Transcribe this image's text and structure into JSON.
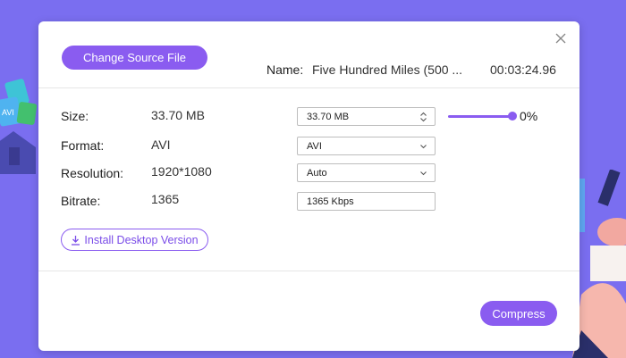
{
  "header": {
    "change_source_label": "Change Source File",
    "name_label": "Name:",
    "file_name": "Five Hundred Miles (500 ...",
    "duration": "00:03:24.96"
  },
  "rows": [
    {
      "label": "Size:",
      "value": "33.70 MB",
      "field": "33.70  MB",
      "field_kind": "stepper"
    },
    {
      "label": "Format:",
      "value": "AVI",
      "field": "AVI",
      "field_kind": "select"
    },
    {
      "label": "Resolution:",
      "value": "1920*1080",
      "field": "Auto",
      "field_kind": "select"
    },
    {
      "label": "Bitrate:",
      "value": "1365",
      "field": "1365 Kbps",
      "field_kind": "input"
    }
  ],
  "compression": {
    "percent_label": "0%",
    "percent": 0
  },
  "install_label": "Install Desktop Version",
  "compress_label": "Compress",
  "background": {
    "deco_text": "AVI"
  },
  "colors": {
    "accent": "#8a5cf0",
    "background": "#7a6ef0"
  }
}
